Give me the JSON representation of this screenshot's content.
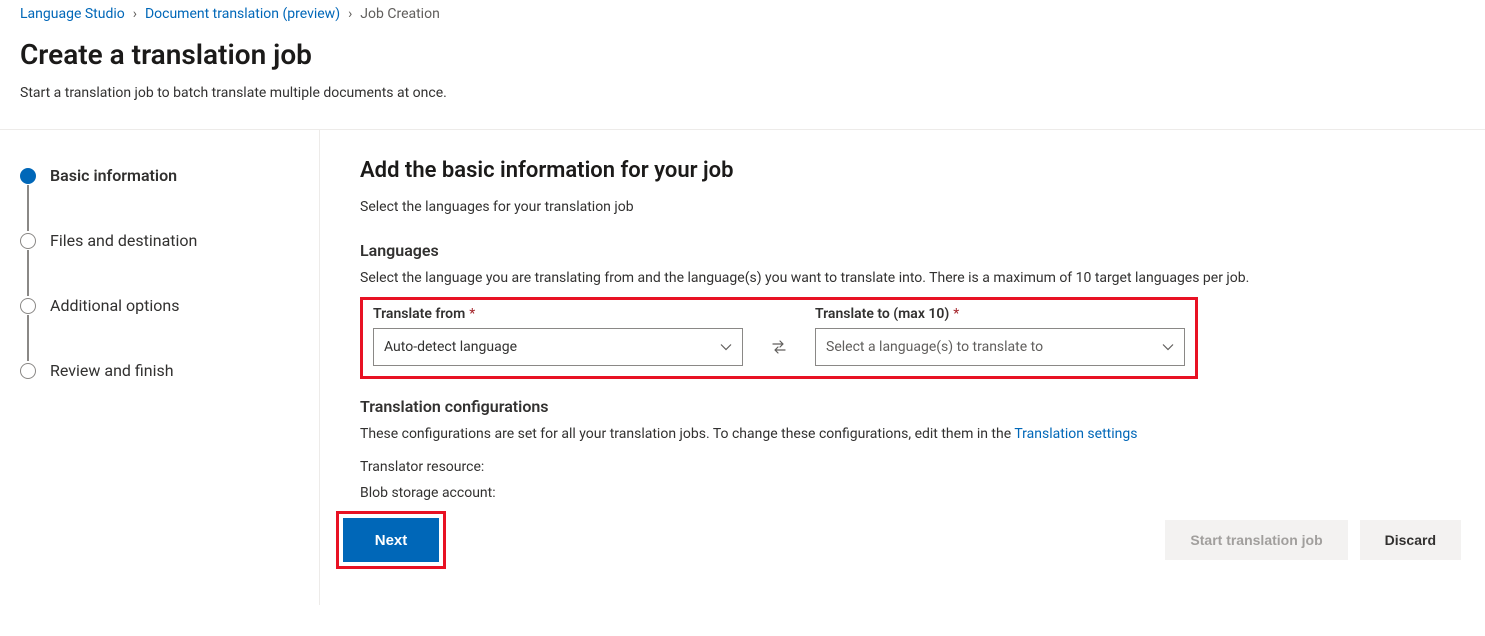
{
  "breadcrumb": {
    "items": [
      {
        "label": "Language Studio",
        "link": true
      },
      {
        "label": "Document translation (preview)",
        "link": true
      },
      {
        "label": "Job Creation",
        "link": false
      }
    ]
  },
  "page": {
    "title": "Create a translation job",
    "subtitle": "Start a translation job to batch translate multiple documents at once."
  },
  "stepper": {
    "steps": [
      {
        "label": "Basic information",
        "active": true
      },
      {
        "label": "Files and destination",
        "active": false
      },
      {
        "label": "Additional options",
        "active": false
      },
      {
        "label": "Review and finish",
        "active": false
      }
    ]
  },
  "main": {
    "title": "Add the basic information for your job",
    "subtitle": "Select the languages for your translation job",
    "languages": {
      "heading": "Languages",
      "description": "Select the language you are translating from and the language(s) you want to translate into. There is a maximum of 10 target languages per job.",
      "from_label": "Translate from",
      "from_value": "Auto-detect language",
      "to_label": "Translate to (max 10)",
      "to_placeholder": "Select a language(s) to translate to"
    },
    "config": {
      "heading": "Translation configurations",
      "description_prefix": "These configurations are set for all your translation jobs. To change these configurations, edit them in the ",
      "settings_link": "Translation settings",
      "translator_label": "Translator resource:",
      "blob_label": "Blob storage account:"
    }
  },
  "footer": {
    "next": "Next",
    "start": "Start translation job",
    "discard": "Discard"
  }
}
